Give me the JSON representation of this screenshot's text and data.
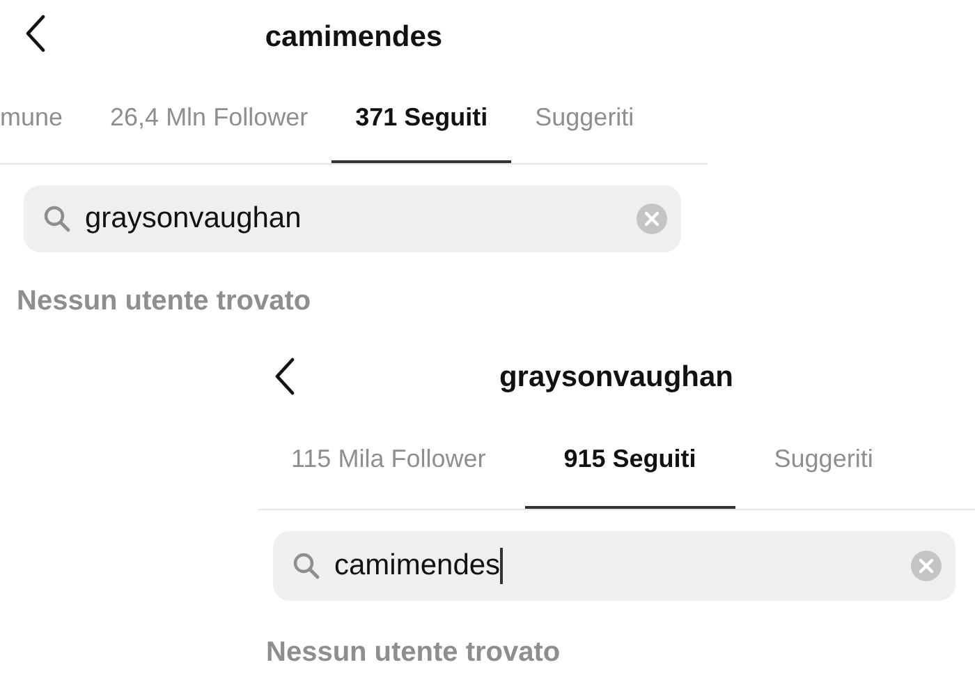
{
  "screens": [
    {
      "title": "camimendes",
      "tabs": [
        {
          "label": "mune",
          "selected": false
        },
        {
          "label": "26,4 Mln Follower",
          "selected": false
        },
        {
          "label": "371 Seguiti",
          "selected": true
        },
        {
          "label": "Suggeriti",
          "selected": false
        }
      ],
      "search": {
        "value": "graysonvaughan",
        "focused": false
      },
      "message": "Nessun utente trovato"
    },
    {
      "title": "graysonvaughan",
      "tabs": [
        {
          "label": "115 Mila Follower",
          "selected": false
        },
        {
          "label": "915 Seguiti",
          "selected": true
        },
        {
          "label": "Suggeriti",
          "selected": false
        }
      ],
      "search": {
        "value": "camimendes",
        "focused": true
      },
      "message": "Nessun utente trovato"
    }
  ]
}
